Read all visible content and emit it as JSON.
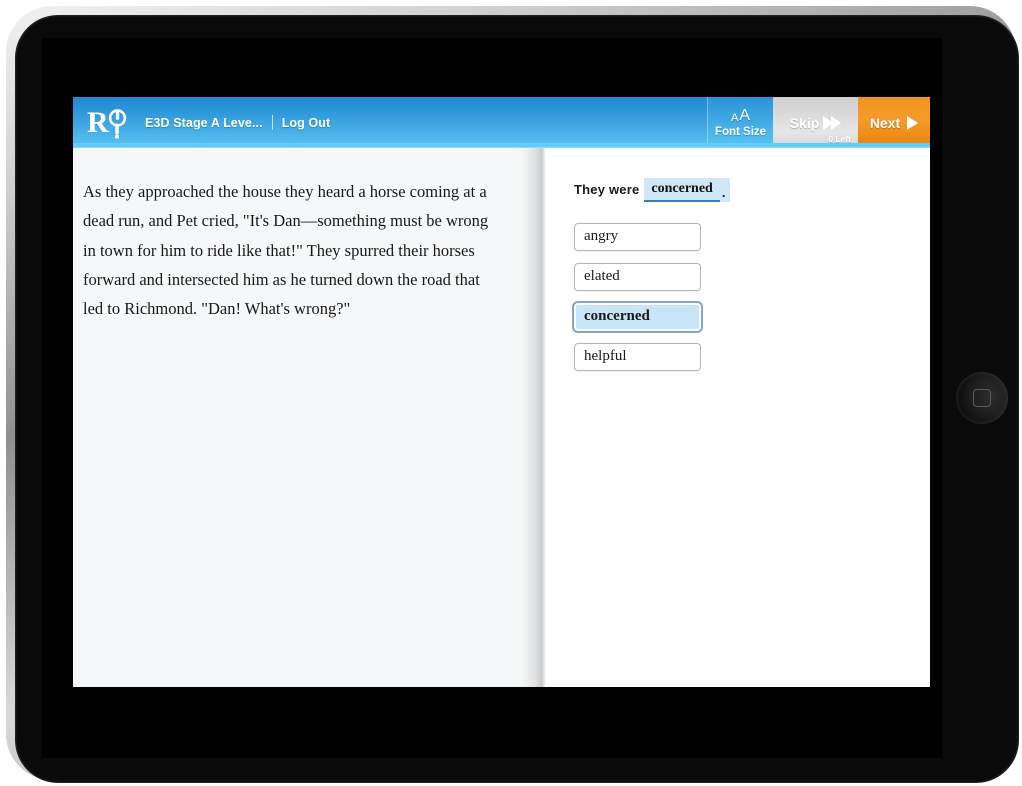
{
  "device": {
    "type": "tablet",
    "orientation": "landscape",
    "home_button_name": "home-button"
  },
  "header": {
    "logo_name": "reading-plus-logo",
    "title": "E3D Stage A Leve...",
    "divider": "|",
    "logout_label": "Log Out",
    "font_size_button": {
      "small_a": "A",
      "large_a": "A",
      "label": "Font Size"
    },
    "skip_button": {
      "label": "Skip",
      "left_count_label": "0 Left",
      "icon": "double-chevron-right-icon"
    },
    "next_button": {
      "label": "Next",
      "icon": "triangle-right-icon"
    },
    "colors": {
      "header_blue_dark": "#1f8bd2",
      "header_blue_light": "#5cc6f5",
      "header_underline": "#63cdf6",
      "next_orange": "#f2941f",
      "skip_gray": "#dcdcdc"
    }
  },
  "passage": {
    "text": "As they approached the house they heard a horse coming at a dead run, and Pet cried, \"It's Dan—something must be wrong in town for him to ride like that!\" They spurred their horses forward and intersected him as he turned down the road that led to Richmond. \"Dan! What's wrong?\""
  },
  "question": {
    "sentence_prefix": "They were",
    "blank_filled_value": "concerned",
    "sentence_suffix": ".",
    "highlight_color": "#cfe7f7",
    "choices": [
      {
        "label": "angry",
        "selected": false
      },
      {
        "label": "elated",
        "selected": false
      },
      {
        "label": "concerned",
        "selected": true
      },
      {
        "label": "helpful",
        "selected": false
      }
    ]
  }
}
